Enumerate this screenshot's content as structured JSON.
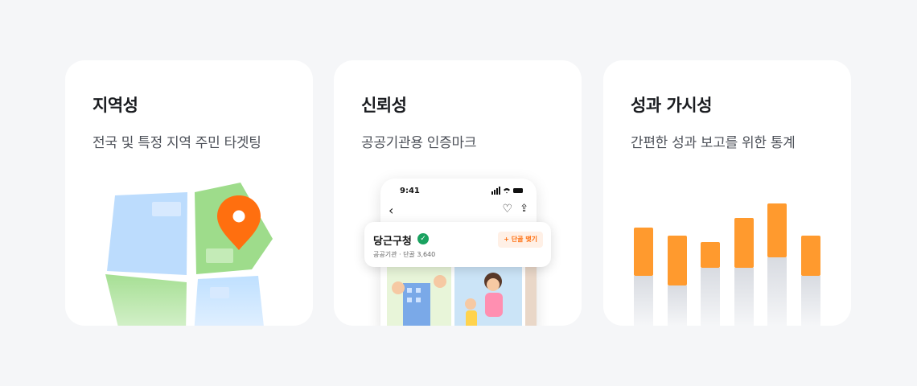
{
  "cards": [
    {
      "title": "지역성",
      "desc": "전국 및 특정 지역 주민 타겟팅"
    },
    {
      "title": "신뢰성",
      "desc": "공공기관용 인증마크"
    },
    {
      "title": "성과 가시성",
      "desc": "간편한 성과 보고를 위한 통계"
    }
  ],
  "phone": {
    "time": "9:41",
    "profile_name": "당근구청",
    "profile_sub": "공공기관 · 단골 3,640",
    "follow_label": "+ 단골 맺기"
  },
  "stats": {
    "orange_values": [
      60,
      62,
      32,
      62,
      67,
      50
    ],
    "gray_values": [
      62,
      50,
      72,
      72,
      85,
      62
    ],
    "colors": {
      "orange": "#ff9a2e",
      "gray": "#dfe1e6"
    }
  },
  "colors": {
    "accent": "#ff6f0f",
    "map_green": "#9fdc8d",
    "map_blue": "#b9dafc",
    "verified": "#1aa260"
  }
}
